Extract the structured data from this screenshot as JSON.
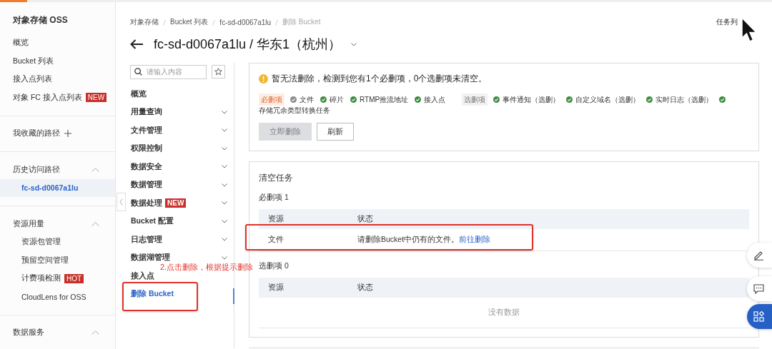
{
  "sidebar": {
    "title": "对象存储 OSS",
    "groups": [
      {
        "kind": "links",
        "items": [
          {
            "label": "概览",
            "selected": false
          },
          {
            "label": "Bucket 列表",
            "selected": false
          },
          {
            "label": "接入点列表",
            "selected": false
          },
          {
            "label": "对象 FC 接入点列表",
            "selected": false,
            "badge": "NEW"
          }
        ]
      },
      {
        "kind": "favorites",
        "title": "我收藏的路径"
      },
      {
        "kind": "section",
        "title": "历史访问路径",
        "expanded": true,
        "items": [
          {
            "label": "fc-sd-d0067a1lu",
            "selected": true
          }
        ]
      },
      {
        "kind": "section",
        "title": "资源用量",
        "expanded": true,
        "items": [
          {
            "label": "资源包管理",
            "selected": false
          },
          {
            "label": "预留空间管理",
            "selected": false
          },
          {
            "label": "计费项检测",
            "selected": false,
            "badge": "HOT"
          },
          {
            "label": "CloudLens for OSS",
            "selected": false
          }
        ]
      },
      {
        "kind": "section",
        "title": "数据服务",
        "expanded": true
      }
    ]
  },
  "breadcrumb": [
    {
      "label": "对象存储",
      "current": false
    },
    {
      "label": "Bucket 列表",
      "current": false
    },
    {
      "label": "fc-sd-d0067a1lu",
      "current": false
    },
    {
      "label": "删除 Bucket",
      "current": true
    }
  ],
  "title": "fc-sd-d0067a1lu / 华东1（杭州）",
  "task_list": "任务列",
  "subnav": {
    "search_placeholder": "请输入内容",
    "items": [
      {
        "label": "概览",
        "expandable": false,
        "selected": false
      },
      {
        "label": "用量查询",
        "expandable": true,
        "selected": false
      },
      {
        "label": "文件管理",
        "expandable": true,
        "selected": false
      },
      {
        "label": "权限控制",
        "expandable": true,
        "selected": false
      },
      {
        "label": "数据安全",
        "expandable": true,
        "selected": false
      },
      {
        "label": "数据管理",
        "expandable": true,
        "selected": false
      },
      {
        "label": "数据处理",
        "expandable": true,
        "selected": false,
        "badge": "NEW"
      },
      {
        "label": "Bucket 配置",
        "expandable": true,
        "selected": false
      },
      {
        "label": "日志管理",
        "expandable": true,
        "selected": false
      },
      {
        "label": "数据湖管理",
        "expandable": true,
        "selected": false
      },
      {
        "label": "接入点",
        "expandable": false,
        "selected": false
      },
      {
        "label": "删除 Bucket",
        "expandable": false,
        "selected": true
      }
    ]
  },
  "delete_check": {
    "message": "暂无法删除，检测到您有1个必删项，0个选删项未清空。",
    "groups": [
      {
        "label": "必删项",
        "kind": "required",
        "items": [
          {
            "label": "文件",
            "cleared": false
          },
          {
            "label": "碎片",
            "cleared": true
          },
          {
            "label": "RTMP推流地址",
            "cleared": true
          },
          {
            "label": "接入点",
            "cleared": true
          }
        ]
      },
      {
        "label": "选删项",
        "kind": "optional",
        "items": [
          {
            "label": "事件通知（选删）",
            "cleared": true
          },
          {
            "label": "自定义域名（选删）",
            "cleared": true
          },
          {
            "label": "实时日志（选删）",
            "cleared": true
          },
          {
            "label": "存储冗余类型转换任务",
            "cleared": true
          }
        ]
      }
    ],
    "buttons": [
      {
        "label": "立即删除",
        "disabled": true
      },
      {
        "label": "刷新",
        "disabled": false
      }
    ]
  },
  "clear_tasks": {
    "title": "清空任务",
    "tables": [
      {
        "title": "必删项 1",
        "columns": [
          "资源",
          "状态"
        ],
        "rows": [
          {
            "resource": "文件",
            "status": "请删除Bucket中仍有的文件。",
            "link": "前往删除"
          }
        ]
      },
      {
        "title": "选删项 0",
        "columns": [
          "资源",
          "状态"
        ],
        "empty_text": "没有数据"
      }
    ]
  },
  "annotation": "2.点击删除，根据提示删除"
}
